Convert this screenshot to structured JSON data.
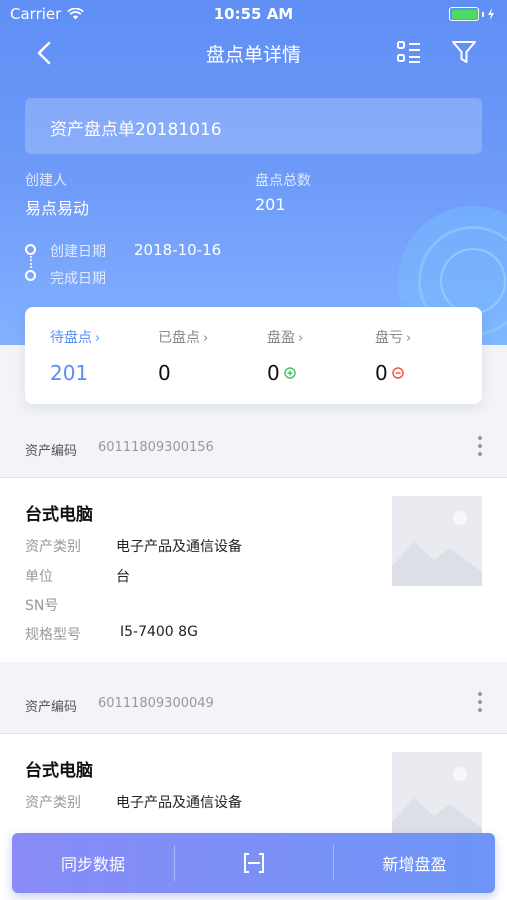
{
  "status_bar": {
    "carrier": "Carrier",
    "time": "10:55 AM"
  },
  "nav": {
    "title": "盘点单详情"
  },
  "order": {
    "title": "资产盘点单20181016",
    "creator_label": "创建人",
    "creator_value": "易点易动",
    "total_label": "盘点总数",
    "total_value": "201",
    "create_date_label": "创建日期",
    "create_date_value": "2018-10-16",
    "finish_date_label": "完成日期"
  },
  "stats": [
    {
      "label": "待盘点",
      "value": "201",
      "active": true
    },
    {
      "label": "已盘点",
      "value": "0"
    },
    {
      "label": "盘盈",
      "value": "0",
      "indicator": "plus-circle-icon",
      "indicator_color": "#4cc46a"
    },
    {
      "label": "盘亏",
      "value": "0",
      "indicator": "minus-circle-icon",
      "indicator_color": "#f05a4a"
    }
  ],
  "assets": [
    {
      "code_label": "资产编码",
      "code_value": "60111809300156",
      "name": "台式电脑",
      "fields": [
        {
          "label": "资产类别",
          "value": "电子产品及通信设备"
        },
        {
          "label": "单位",
          "value": "台"
        },
        {
          "label": "SN号",
          "value": ""
        },
        {
          "label": "规格型号",
          "value": "I5-7400 8G"
        }
      ]
    },
    {
      "code_label": "资产编码",
      "code_value": "60111809300049",
      "name": "台式电脑",
      "fields": [
        {
          "label": "资产类别",
          "value": "电子产品及通信设备"
        }
      ]
    }
  ],
  "bottom_bar": {
    "sync_label": "同步数据",
    "scan_icon": "scan-icon",
    "add_label": "新增盘盈"
  },
  "colors": {
    "accent": "#5a8ef5",
    "header_top": "#5f8ef5",
    "header_bottom": "#84b0ff"
  }
}
